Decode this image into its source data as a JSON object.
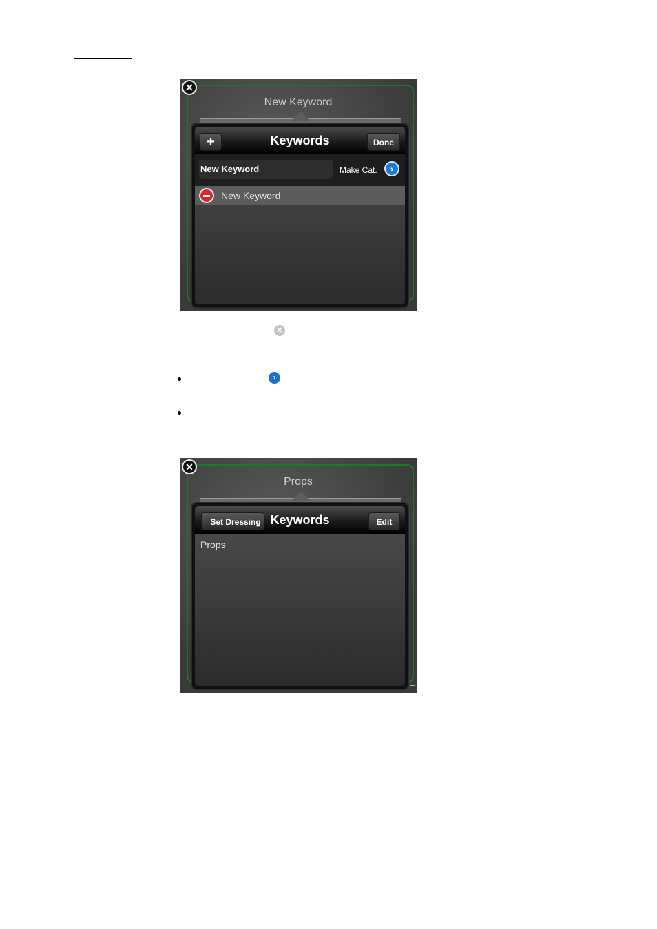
{
  "screenshot1": {
    "close_glyph": "✕",
    "popover_title": "New Keyword",
    "nav_title": "Keywords",
    "add_glyph": "+",
    "done_label": "Done",
    "input_value": "New Keyword",
    "make_cat_label": "Make Cat.",
    "chevron_glyph": "›",
    "list_item": "New Keyword"
  },
  "screenshot2": {
    "close_glyph": "✕",
    "popover_title": "Props",
    "nav_title": "Keywords",
    "back_label": "Set Dressing",
    "edit_label": "Edit",
    "content_label": "Props"
  },
  "inline_icons": {
    "clear_glyph": "✕",
    "chevron_glyph": "›"
  },
  "colors": {
    "frame_green": "#1b7a2a",
    "accent_blue": "#1b7bd8",
    "delete_red": "#d42a2a"
  }
}
